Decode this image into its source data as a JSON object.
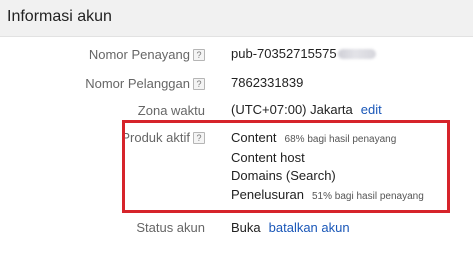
{
  "header": {
    "title": "Informasi akun"
  },
  "rows": {
    "publisher_id": {
      "label": "Nomor Penayang",
      "help": "?",
      "value": "pub-70352715575"
    },
    "customer_id": {
      "label": "Nomor Pelanggan",
      "help": "?",
      "value": "7862331839"
    },
    "timezone": {
      "label": "Zona waktu",
      "value": "(UTC+07:00) Jakarta",
      "edit_link": "edit"
    },
    "products": {
      "label": "Produk aktif",
      "help": "?",
      "items": [
        {
          "name": "Content",
          "share": "68% bagi hasil penayang"
        },
        {
          "name": "Content host",
          "share": ""
        },
        {
          "name": "Domains (Search)",
          "share": ""
        },
        {
          "name": "Penelusuran",
          "share": "51% bagi hasil penayang"
        }
      ]
    },
    "status": {
      "label": "Status akun",
      "value": "Buka",
      "cancel_link": "batalkan akun"
    }
  },
  "highlight_color": "#d6232a",
  "link_color": "#1a57b8"
}
